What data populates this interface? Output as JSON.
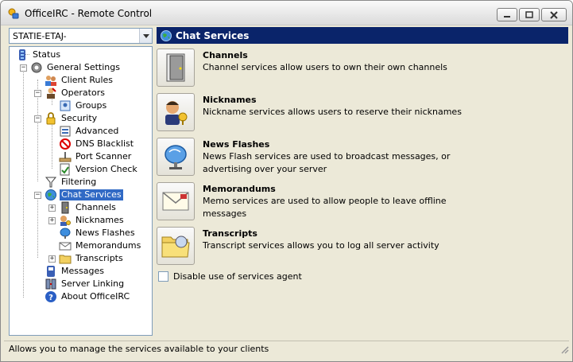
{
  "window": {
    "title": "OfficeIRC - Remote Control"
  },
  "server": {
    "selected": "STATIE-ETAJ-"
  },
  "tree": {
    "items": [
      {
        "label": "Status",
        "icon": "status-icon"
      },
      {
        "label": "General Settings",
        "icon": "gear-icon"
      },
      {
        "label": "Client Rules",
        "icon": "users-icon"
      },
      {
        "label": "Operators",
        "icon": "operators-icon"
      },
      {
        "label": "Groups",
        "icon": "groups-icon"
      },
      {
        "label": "Security",
        "icon": "lock-icon"
      },
      {
        "label": "Advanced",
        "icon": "advanced-icon"
      },
      {
        "label": "DNS Blacklist",
        "icon": "blacklist-icon"
      },
      {
        "label": "Port Scanner",
        "icon": "scanner-icon"
      },
      {
        "label": "Version Check",
        "icon": "version-icon"
      },
      {
        "label": "Filtering",
        "icon": "filter-icon"
      },
      {
        "label": "Chat Services",
        "icon": "globe-icon"
      },
      {
        "label": "Channels",
        "icon": "door-icon"
      },
      {
        "label": "Nicknames",
        "icon": "nickname-icon"
      },
      {
        "label": "News Flashes",
        "icon": "satellite-icon"
      },
      {
        "label": "Memorandums",
        "icon": "envelope-icon"
      },
      {
        "label": "Transcripts",
        "icon": "folder-icon"
      },
      {
        "label": "Messages",
        "icon": "messages-icon"
      },
      {
        "label": "Server Linking",
        "icon": "link-icon"
      },
      {
        "label": "About OfficeIRC",
        "icon": "help-icon"
      }
    ]
  },
  "panel": {
    "title": "Chat Services",
    "icon": "globe-icon"
  },
  "services": [
    {
      "title": "Channels",
      "desc": "Channel services allow users to own their own channels",
      "icon": "door-icon"
    },
    {
      "title": "Nicknames",
      "desc": "Nickname services allows users to reserve their nicknames",
      "icon": "nickname-icon"
    },
    {
      "title": "News Flashes",
      "desc": "News Flash services are used to broadcast messages, or advertising over your server",
      "icon": "satellite-icon"
    },
    {
      "title": "Memorandums",
      "desc": "Memo services are used to allow people to leave offline messages",
      "icon": "envelope-icon"
    },
    {
      "title": "Transcripts",
      "desc": "Transcript services allows you to log all server activity",
      "icon": "folder-icon"
    }
  ],
  "options": {
    "disable_agent_label": "Disable use of services agent",
    "disable_agent_checked": false
  },
  "statusbar": {
    "text": "Allows you to manage the services available to your clients"
  },
  "colors": {
    "header_bg": "#0a246a",
    "selection": "#316ac5",
    "window_bg": "#ece9d8"
  }
}
